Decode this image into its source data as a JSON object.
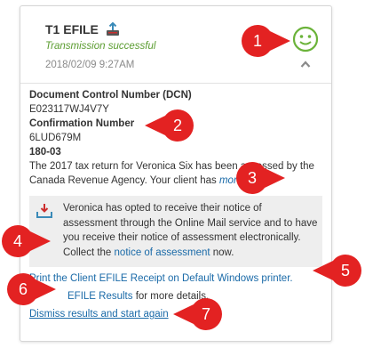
{
  "header": {
    "title": "T1 EFILE",
    "status": "Transmission successful",
    "timestamp": "2018/02/09 9:27AM"
  },
  "details": {
    "dcn_label": "Document Control Number (DCN)",
    "dcn_value": "E023117WJ4V7Y",
    "confirmation_label": "Confirmation Number",
    "confirmation_value": "6LUD679M",
    "code": "180-03",
    "message": "The 2017 tax return for Veronica Six has been assessed by the Canada Revenue Agency. Your client has ",
    "more_link": "more"
  },
  "notice": {
    "text_before": "Veronica has opted to receive their notice of assessment through the Online Mail service and to have you receive their notice of assessment electronically. Collect the ",
    "link": "notice of assessment",
    "text_after": " now."
  },
  "actions": {
    "print_link": "Print the Client EFILE Receipt on Default Windows printer.",
    "results_link": "EFILE Results",
    "results_suffix": " for more details.",
    "dismiss_link": "Dismiss results and start again"
  },
  "callouts": [
    "1",
    "2",
    "3",
    "4",
    "5",
    "6",
    "7"
  ],
  "colors": {
    "success_green": "#5a9c2f",
    "link_blue": "#1a6aa8",
    "callout_red": "#e32222"
  }
}
